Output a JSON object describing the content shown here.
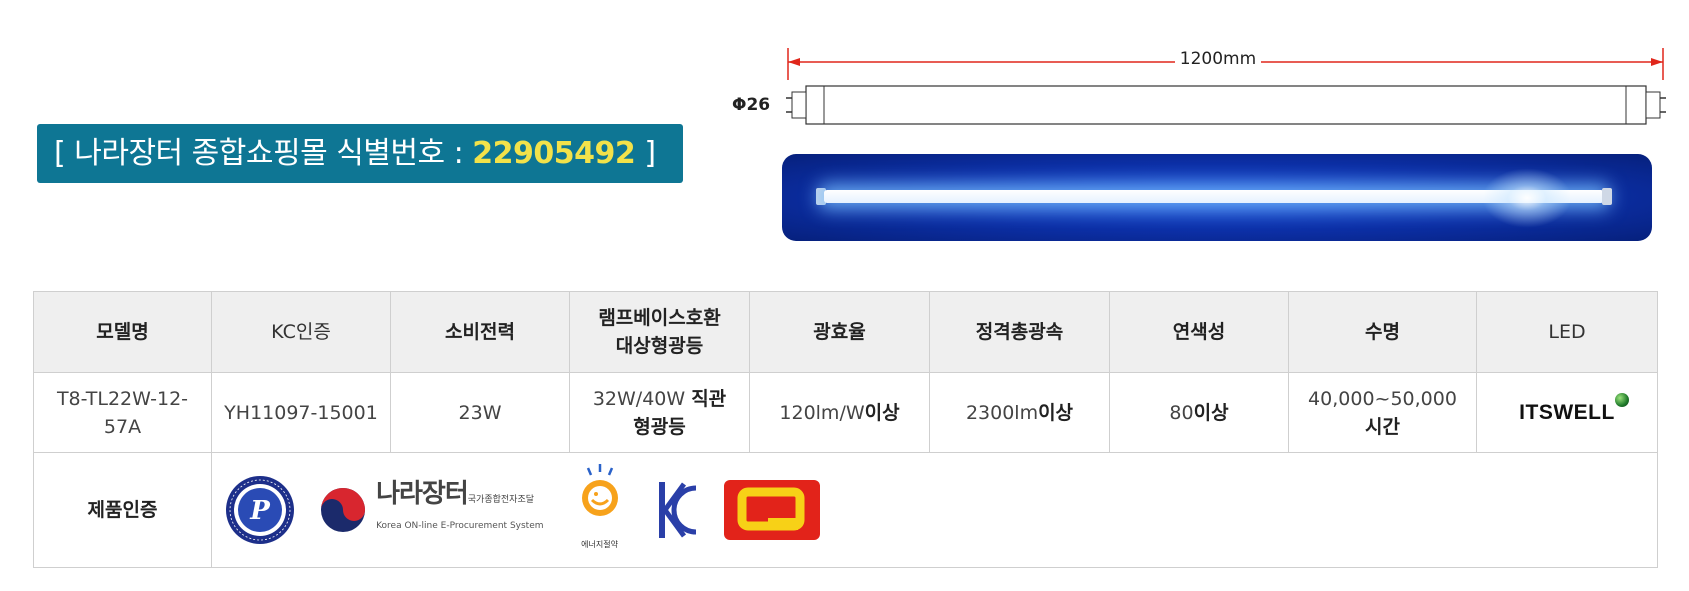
{
  "banner": {
    "prefix": "[ 나라장터 종합쇼핑몰 식별번호 : ",
    "number": "22905492",
    "suffix": " ]"
  },
  "drawing": {
    "length_label": "1200mm",
    "diameter_label": "Φ26"
  },
  "spec_table": {
    "headers": [
      "모델명",
      "KC인증",
      "소비전력",
      "램프베이스호환",
      "대상형광등",
      "광효율",
      "정격총광속",
      "연색성",
      "수명",
      "LED"
    ],
    "model": "T8-TL22W-12-57A",
    "kc": "YH11097-15001",
    "power": "23W",
    "lamp_plain": "32W/40W ",
    "lamp_bold_1": "직관",
    "lamp_bold_2": "형광등",
    "efficacy_plain": "120lm/W",
    "efficacy_bold": "이상",
    "flux_plain": "2300lm",
    "flux_bold": "이상",
    "cri_plain": "80",
    "cri_bold": "이상",
    "life_plain": "40,000~50,000",
    "life_bold": "시간",
    "brand": "ITSWELL",
    "cert_label": "제품인증"
  },
  "logos": {
    "nara_title": "나라장터",
    "nara_small": "국가종합전자조달",
    "nara_sub": "Korea ON-line E-Procurement System",
    "energy_caption": "에너지절약",
    "kc_mark": "KC",
    "q_mark": "Q"
  },
  "colors": {
    "banner_bg": "#0e7694",
    "banner_number": "#f2e24a",
    "dimension_line": "#e0261b",
    "header_bg": "#efefef",
    "glow_bg": "#0c2fa6"
  }
}
